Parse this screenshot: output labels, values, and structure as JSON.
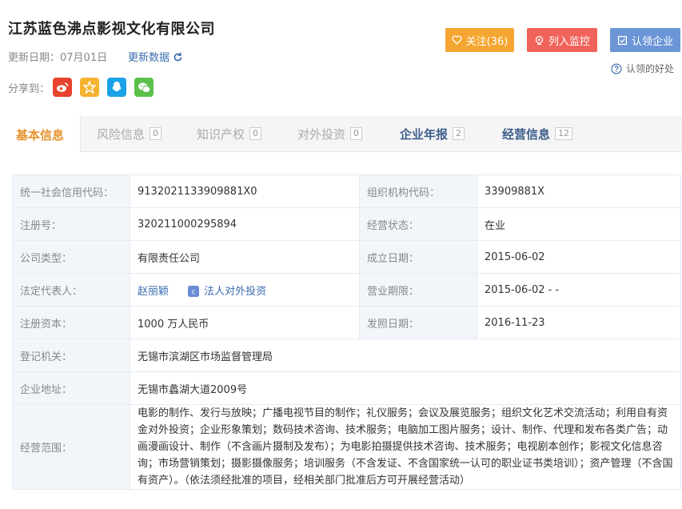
{
  "company": {
    "name": "江苏蓝色沸点影视文化有限公司"
  },
  "meta": {
    "update_date": "更新日期：07月01日",
    "refresh_label": "更新数据"
  },
  "share": {
    "label": "分享到：",
    "icons": [
      "weibo-icon",
      "qzone-icon",
      "qq-icon",
      "wechat-icon"
    ]
  },
  "actions": {
    "follow": "关注(36)",
    "monitor": "列入监控",
    "claim": "认领企业",
    "claim_benefit": "认领的好处"
  },
  "colors": {
    "follow": "#f5a632",
    "monitor": "#f0635a",
    "claim": "#6b95d6",
    "link": "#3a6cb0",
    "accent": "#e8922b"
  },
  "tabs": [
    {
      "label": "基本信息",
      "count": ""
    },
    {
      "label": "风险信息",
      "count": "0"
    },
    {
      "label": "知识产权",
      "count": "0"
    },
    {
      "label": "对外投资",
      "count": "0"
    },
    {
      "label": "企业年报",
      "count": "2"
    },
    {
      "label": "经营信息",
      "count": "12"
    }
  ],
  "info": {
    "credit_code_label": "统一社会信用代码：",
    "credit_code": "913202113390988​1X0",
    "org_code_label": "组织机构代码：",
    "org_code": "33909881X",
    "reg_no_label": "注册号：",
    "reg_no": "320211000295894",
    "status_label": "经营状态：",
    "status": "在业",
    "type_label": "公司类型：",
    "type": "有限责任公司",
    "founded_label": "成立日期：",
    "founded": "2015-06-02",
    "legal_rep_label": "法定代表人：",
    "legal_rep": "赵丽颖",
    "legal_invest": "法人对外投资",
    "term_label": "营业期限：",
    "term": "2015-06-02 - -",
    "capital_label": "注册资本：",
    "capital": "1000 万人民币",
    "issue_label": "发照日期：",
    "issue": "2016-11-23",
    "authority_label": "登记机关：",
    "authority": "无锡市滨湖区市场监督管理局",
    "address_label": "企业地址：",
    "address": "无锡市蠡湖大道2009号",
    "scope_label": "经营范围：",
    "scope": "电影的制作、发行与放映；广播电视节目的制作；礼仪服务；会议及展览服务；组织文化艺术交流活动；利用自有资金对外投资；企业形象策划；数码技术咨询、技术服务；电脑加工图片服务；设计、制作、代理和发布各类广告；动画漫画设计、制作（不含画片摄制及发布）；为电影拍摄提供技术咨询、技术服务；电视剧本创作；影视文化信息咨询；市场营销策划；摄影摄像服务；培训服务（不含发证、不含国家统一认可的职业证书类培训）；资产管理（不含国有资产）。（依法须经批准的项目，经相关部门批准后方可开展经营活动）"
  }
}
